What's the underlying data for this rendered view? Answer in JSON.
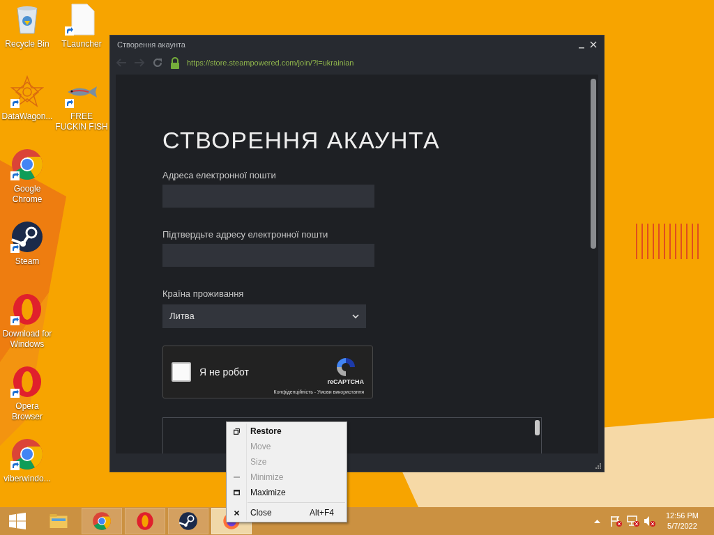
{
  "desktop_icons": [
    {
      "label": "Recycle Bin",
      "kind": "recycle-bin"
    },
    {
      "label": "DataWagon...",
      "kind": "star-pattern"
    },
    {
      "label": "Google Chrome",
      "kind": "chrome"
    },
    {
      "label": "Steam",
      "kind": "steam"
    },
    {
      "label": "Download for Windows",
      "kind": "opera"
    },
    {
      "label": "Opera Browser",
      "kind": "opera"
    },
    {
      "label": "viberwindo...",
      "kind": "chrome"
    },
    {
      "label": "TLauncher",
      "kind": "document"
    },
    {
      "label": "FREE FUCKIN FISH",
      "kind": "fish"
    }
  ],
  "window": {
    "title": "Створення акаунта",
    "url": "https://store.steampowered.com/join/?l=ukrainian",
    "heading": "СТВОРЕННЯ АКАУНТА",
    "fields": [
      {
        "kind": "text",
        "label": "Адреса електронної пошти"
      },
      {
        "kind": "text",
        "label": "Підтвердьте адресу електронної пошти"
      },
      {
        "kind": "select",
        "label": "Країна проживання",
        "value": "Литва"
      }
    ],
    "captcha": {
      "label": "Я не робот",
      "checked": false,
      "brand": "reCAPTCHA",
      "links": "Конфіденційність - Умови використання"
    }
  },
  "context_menu": {
    "items": [
      {
        "kind": "restore",
        "label": "Restore",
        "default": true,
        "disabled": false
      },
      {
        "kind": "move",
        "label": "Move",
        "default": false,
        "disabled": true
      },
      {
        "kind": "size",
        "label": "Size",
        "default": false,
        "disabled": true
      },
      {
        "kind": "minimize",
        "label": "Minimize",
        "default": false,
        "disabled": true
      },
      {
        "kind": "maximize",
        "label": "Maximize",
        "default": false,
        "disabled": false
      },
      {
        "kind": "separator"
      },
      {
        "kind": "close",
        "label": "Close",
        "shortcut": "Alt+F4",
        "default": false,
        "disabled": false
      }
    ]
  },
  "taskbar": {
    "apps": [
      {
        "kind": "explorer",
        "selected": false
      },
      {
        "kind": "chrome",
        "selected": false
      },
      {
        "kind": "opera",
        "selected": false
      },
      {
        "kind": "steam",
        "selected": false
      },
      {
        "kind": "firefox",
        "selected": true
      }
    ],
    "time": "12:56 PM",
    "date": "5/7/2022"
  }
}
